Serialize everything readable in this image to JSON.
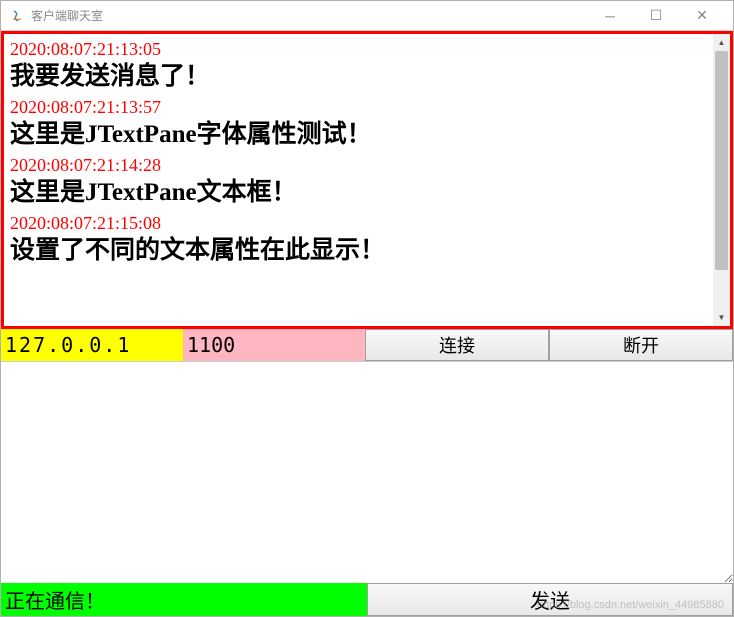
{
  "window": {
    "title": "客户端聊天室",
    "icon": "java-icon"
  },
  "chat": {
    "messages": [
      {
        "timestamp": "2020:08:07:21:13:05",
        "text": "我要发送消息了！"
      },
      {
        "timestamp": "2020:08:07:21:13:57",
        "text": "这里是JTextPane字体属性测试！"
      },
      {
        "timestamp": "2020:08:07:21:14:28",
        "text": "这里是JTextPane文本框！"
      },
      {
        "timestamp": "2020:08:07:21:15:08",
        "text": "设置了不同的文本属性在此显示！"
      }
    ]
  },
  "connection": {
    "ip": "127.0.0.1",
    "port": "1100",
    "connect_label": "连接",
    "disconnect_label": "断开"
  },
  "compose": {
    "value": ""
  },
  "bottom": {
    "status": "正在通信！",
    "send_label": "发送"
  },
  "watermark": "https://blog.csdn.net/weixin_44985880",
  "colors": {
    "ip_bg": "#ffff00",
    "port_bg": "#ffb6c1",
    "status_bg": "#00ff00",
    "chat_border": "#ff0000",
    "timestamp": "#ff0000"
  }
}
